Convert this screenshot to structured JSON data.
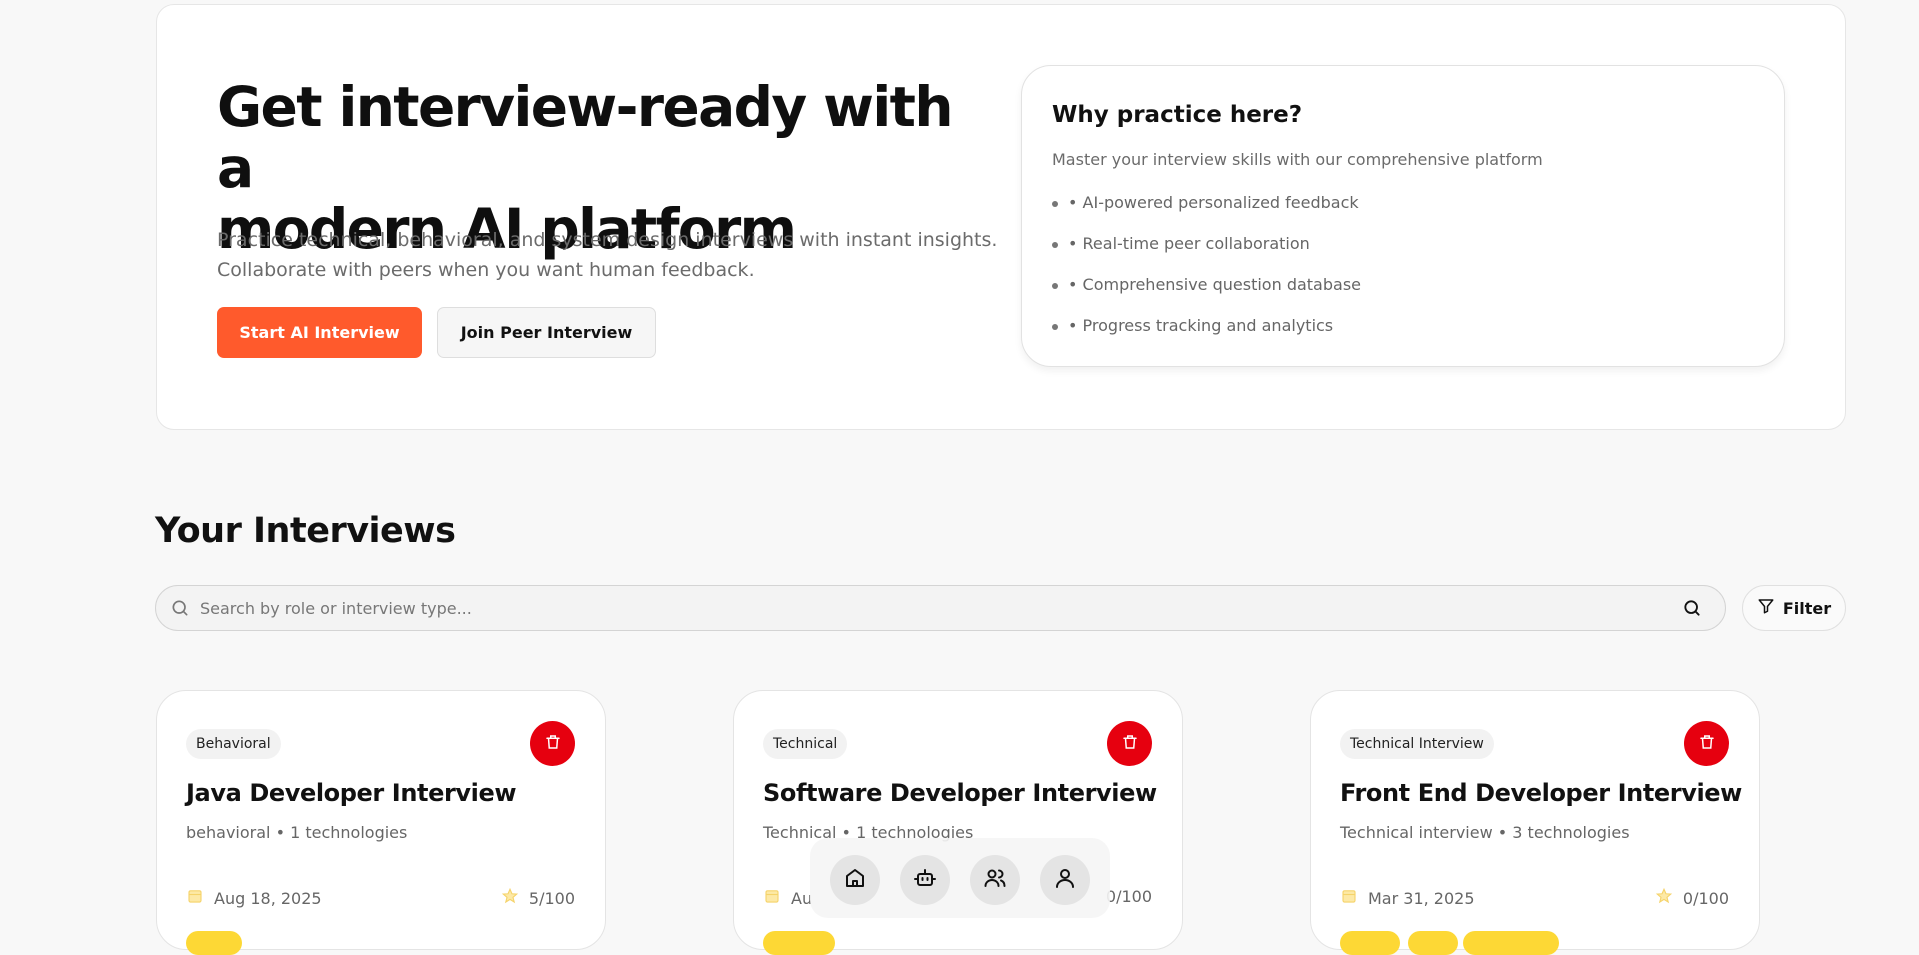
{
  "hero": {
    "title_line1": "Get interview-ready with a",
    "title_line2": "modern AI platform",
    "subtitle_line1": "Practice technical, behavioral, and system design interviews with instant insights.",
    "subtitle_line2": "Collaborate with peers when you want human feedback.",
    "primary_button": "Start AI Interview",
    "secondary_button": "Join Peer Interview",
    "accent_color": "#ff5a2c"
  },
  "why": {
    "title": "Why practice here?",
    "subtitle": "Master your interview skills with our comprehensive platform",
    "items": [
      "• AI-powered personalized feedback",
      "• Real-time peer collaboration",
      "• Comprehensive question database",
      "• Progress tracking and analytics"
    ]
  },
  "interviews": {
    "title": "Your Interviews",
    "search_placeholder": "Search by role or interview type...",
    "filter_label": "Filter",
    "cards": [
      {
        "badge": "Behavioral",
        "title": "Java Developer Interview",
        "meta": "behavioral • 1 technologies",
        "date": "Aug 18, 2025",
        "score": "5/100"
      },
      {
        "badge": "Technical",
        "title": "Software Developer Interview",
        "meta": "Technical • 1 technologies",
        "date": "Au",
        "score": "0/100"
      },
      {
        "badge": "Technical Interview",
        "title": "Front End Developer Interview",
        "meta": "Technical interview • 3 technologies",
        "date": "Mar 31, 2025",
        "score": "0/100"
      }
    ],
    "delete_color": "#e6000f",
    "chip_color": "#fdd835"
  },
  "dock": {
    "icons": [
      "home-icon",
      "bot-icon",
      "users-icon",
      "user-icon"
    ]
  }
}
